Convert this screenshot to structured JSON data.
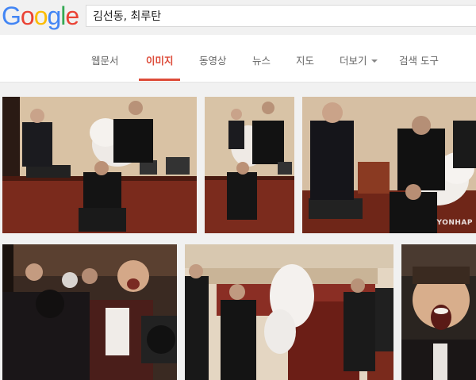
{
  "logo": {
    "letters": [
      "G",
      "o",
      "o",
      "g",
      "l",
      "e"
    ],
    "colors": [
      "#4285f4",
      "#ea4335",
      "#fbbc05",
      "#4285f4",
      "#34a853",
      "#ea4335"
    ]
  },
  "search": {
    "query": "김선동, 최루탄"
  },
  "tabs": [
    {
      "label": "웹문서"
    },
    {
      "label": "이미지",
      "active": true
    },
    {
      "label": "동영상"
    },
    {
      "label": "뉴스"
    },
    {
      "label": "지도"
    },
    {
      "label": "더보기"
    },
    {
      "label": "검색 도구"
    }
  ],
  "accent_color": "#dd4b39",
  "results": [
    {
      "watermark": ""
    },
    {
      "watermark": ""
    },
    {
      "watermark": "YONHAP"
    },
    {
      "watermark": ""
    },
    {
      "watermark": ""
    },
    {
      "watermark": ""
    }
  ]
}
